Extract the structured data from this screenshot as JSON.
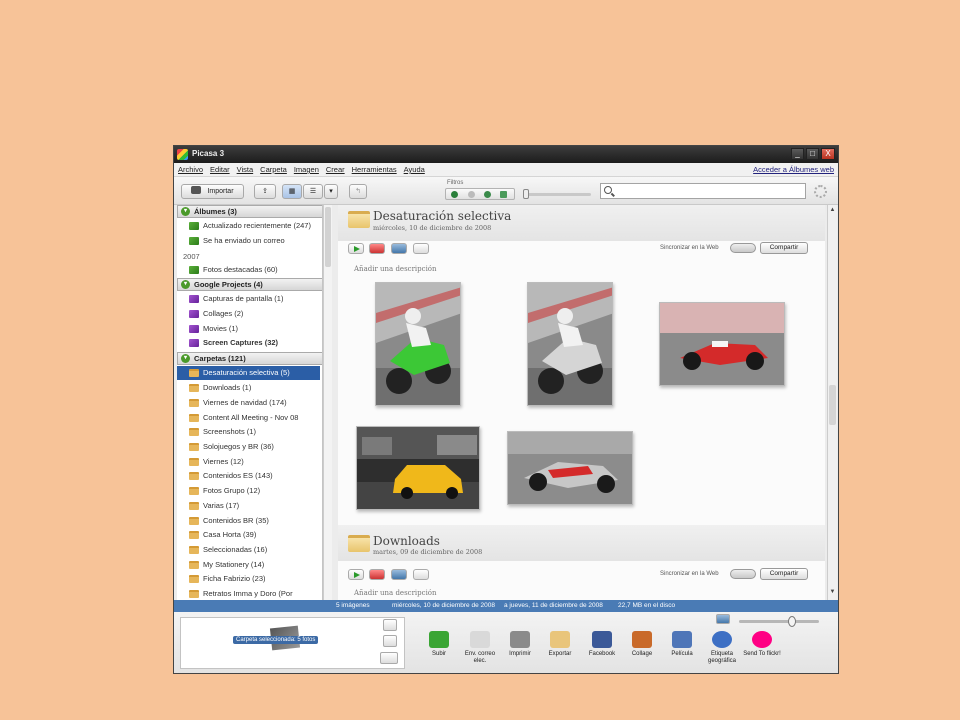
{
  "window": {
    "title": "Picasa 3",
    "controls": [
      "_",
      "□",
      "X"
    ]
  },
  "menu": {
    "items": [
      "Archivo",
      "Editar",
      "Vista",
      "Carpeta",
      "Imagen",
      "Crear",
      "Herramientas",
      "Ayuda"
    ],
    "link": "Acceder a Álbumes web"
  },
  "toolbar": {
    "import_label": "Importar",
    "filters_label": "Filtros"
  },
  "left": {
    "albums_header": "Álbumes (3)",
    "albums": [
      "Actualizado recientemente (247)",
      "Se ha enviado un correo"
    ],
    "year": "2007",
    "year_items": [
      "Fotos destacadas (60)"
    ],
    "projects_header": "Google Projects (4)",
    "projects": [
      "Capturas de pantalla (1)",
      "Collages (2)",
      "Movies (1)",
      "Screen Captures (32)"
    ],
    "folders_header": "Carpetas (121)",
    "folders": [
      "Desaturación selectiva (5)",
      "Downloads (1)",
      "Viernes de navidad (174)",
      "Content All Meeting - Nov 08",
      "Screenshots (1)",
      "Solojuegos y BR (36)",
      "Viernes (12)",
      "Contenidos ES (143)",
      "Fotos Grupo (12)",
      "Varias (17)",
      "Contenidos BR (35)",
      "Casa Horta (39)",
      "Seleccionadas (16)",
      "My Stationery (14)",
      "Ficha Fabrizio (23)",
      "Retratos Imma y Doro (Por"
    ]
  },
  "main": {
    "section1": {
      "title": "Desaturación selectiva",
      "date": "miércoles, 10 de diciembre de 2008",
      "sync": "Sincronizar en la Web",
      "share": "Compartir",
      "add_description": "Añadir una descripción"
    },
    "section2": {
      "title": "Downloads",
      "date": "martes, 09 de diciembre de 2008",
      "sync": "Sincronizar en la Web",
      "share": "Compartir",
      "add_description": "Añadir una descripción"
    },
    "photos": [
      {
        "name": "photo-motorbike-green",
        "subject": "motorcycle green"
      },
      {
        "name": "photo-motorbike-grey",
        "subject": "motorcycle desaturated"
      },
      {
        "name": "photo-f1-ferrari",
        "subject": "formula one red car"
      },
      {
        "name": "photo-taxi",
        "subject": "yellow taxi"
      },
      {
        "name": "photo-f1-mclaren",
        "subject": "formula one silver car"
      }
    ]
  },
  "status": {
    "count": "5 imágenes",
    "from": "miércoles, 10 de diciembre de 2008",
    "to": "a jueves, 11 de diciembre de 2008",
    "size": "22,7 MB en el disco"
  },
  "tray": {
    "hold_label": "Carpeta seleccionada: 5 fotos",
    "actions": [
      {
        "label": "Subir",
        "color": "#3aa534"
      },
      {
        "label": "Env. correo elec.",
        "color": "#d9d9d9"
      },
      {
        "label": "Imprimir",
        "color": "#8a8a8a"
      },
      {
        "label": "Exportar",
        "color": "#e9c57b"
      },
      {
        "label": "Facebook",
        "color": "#3b5998"
      },
      {
        "label": "Collage",
        "color": "#c96a2a"
      },
      {
        "label": "Película",
        "color": "#4f76b8"
      },
      {
        "label": "Etiqueta geográfica",
        "color": "#3d6fc4"
      },
      {
        "label": "Send To flickr!",
        "color": "#ff0084"
      }
    ]
  },
  "colors": {
    "background": "#f7c398",
    "selection": "#2b5ea6",
    "statusbar": "#4a7bb5"
  }
}
